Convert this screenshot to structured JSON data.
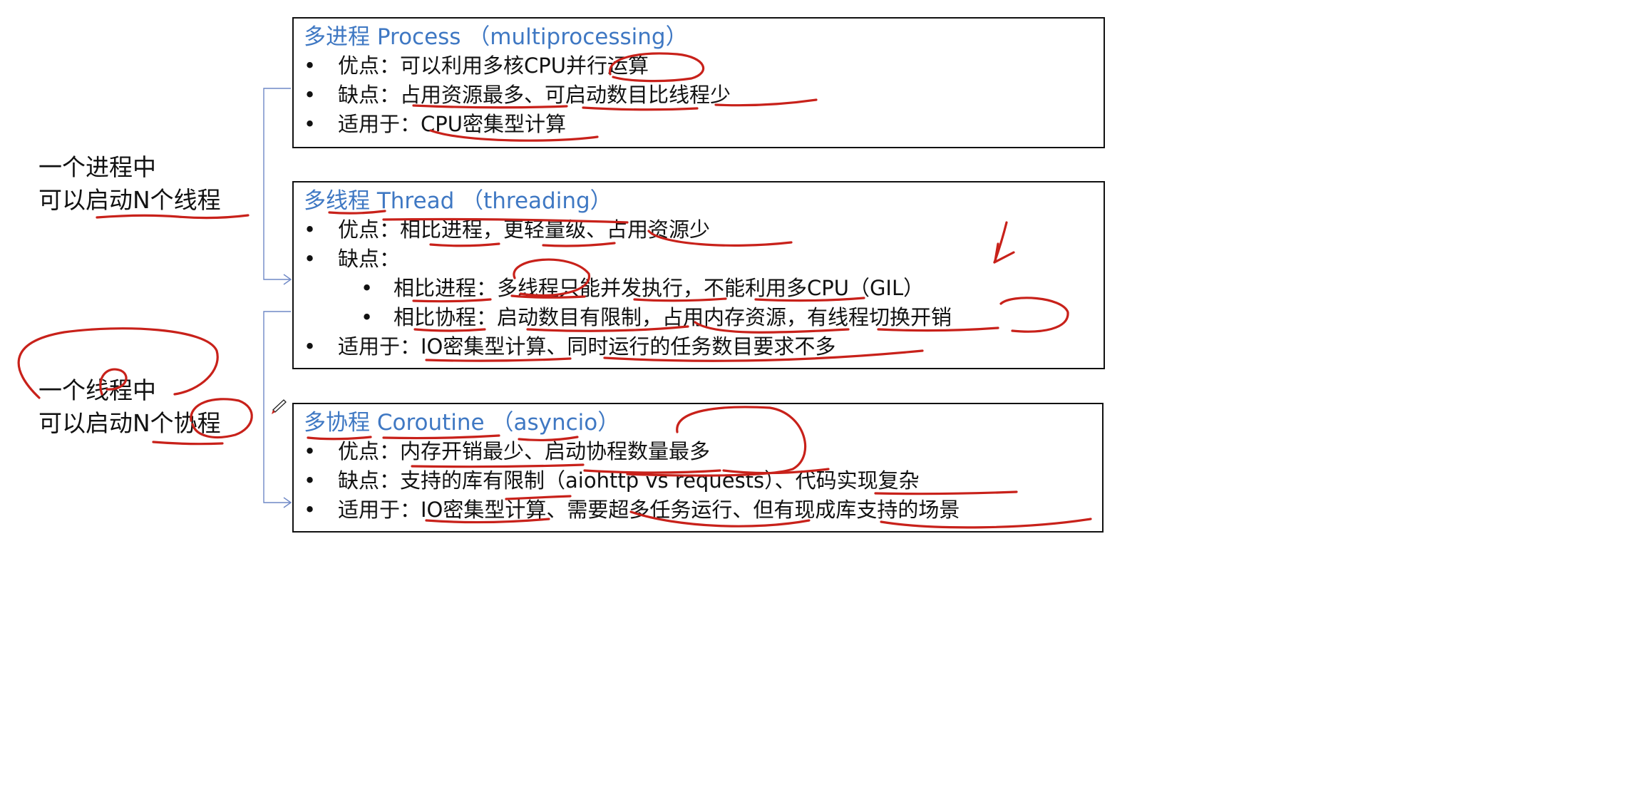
{
  "left_labels": {
    "process": {
      "line1": "一个进程中",
      "line2": "可以启动N个线程"
    },
    "thread": {
      "line1": "一个线程中",
      "line2": "可以启动N个协程"
    }
  },
  "boxes": {
    "process": {
      "title": "多进程 Process （multiprocessing）",
      "items": [
        {
          "bullet": "•",
          "text": "优点：可以利用多核CPU并行运算"
        },
        {
          "bullet": "•",
          "text": "缺点：占用资源最多、可启动数目比线程少"
        },
        {
          "bullet": "•",
          "text": "适用于：CPU密集型计算"
        }
      ]
    },
    "thread": {
      "title": "多线程 Thread （threading）",
      "items": [
        {
          "bullet": "•",
          "text": "优点：相比进程，更轻量级、占用资源少"
        },
        {
          "bullet": "•",
          "text": "缺点："
        },
        {
          "bullet": "•",
          "text": "相比进程：多线程只能并发执行，不能利用多CPU（GIL）"
        },
        {
          "bullet": "•",
          "text": "相比协程：启动数目有限制，占用内存资源，有线程切换开销"
        },
        {
          "bullet": "•",
          "text": "适用于：IO密集型计算、同时运行的任务数目要求不多"
        }
      ]
    },
    "coroutine": {
      "title": "多协程 Coroutine （asyncio）",
      "items": [
        {
          "bullet": "•",
          "text": "优点：内存开销最少、启动协程数量最多"
        },
        {
          "bullet": "•",
          "text": "缺点：支持的库有限制（aiohttp vs requests）、代码实现复杂"
        },
        {
          "bullet": "•",
          "text": "适用于：IO密集型计算、需要超多任务运行、但有现成库支持的场景"
        }
      ]
    }
  },
  "colors": {
    "title_blue": "#3f78c3",
    "ink_red": "#c8211a",
    "connector_blue": "#6f88c6",
    "text": "#111111",
    "border": "#111111"
  },
  "icons": {
    "pen": "pen-cursor-icon"
  }
}
